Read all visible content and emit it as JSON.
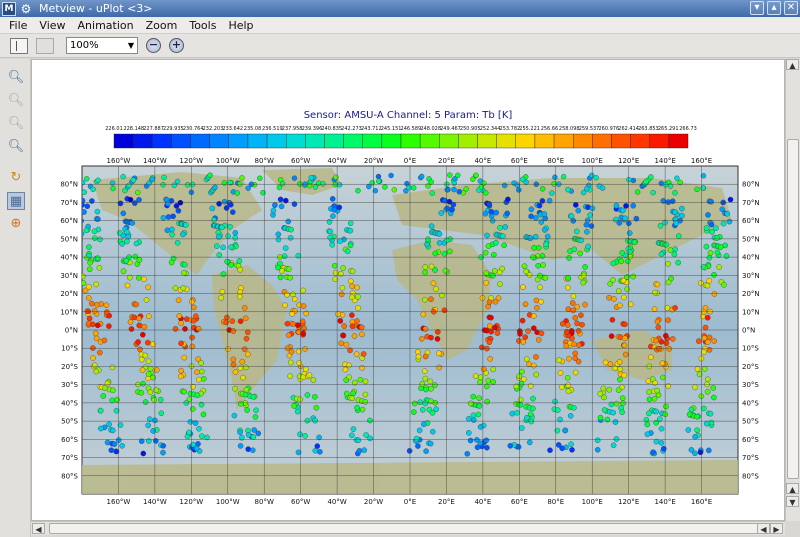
{
  "window": {
    "title": "Metview - uPlot <3>",
    "app_icon": "metview-app-icon",
    "controls": [
      "minimize-icon",
      "maximize-icon",
      "close-icon"
    ]
  },
  "menu": {
    "items": [
      "File",
      "View",
      "Animation",
      "Zoom",
      "Tools",
      "Help"
    ]
  },
  "toolbar": {
    "zoom_value": "100%",
    "icons": [
      "layout-icon",
      "frame-icon",
      "zoom-out-icon",
      "zoom-in-icon"
    ]
  },
  "left_tools": [
    "magnifier-icon",
    "zoom-in-icon",
    "zoom-out-icon",
    "zoom-area-icon",
    "data-probe-icon",
    "layers-icon",
    "globe-icon"
  ],
  "chart_data": {
    "type": "scatter",
    "title": "Sensor: AMSU-A Channel: 5 Param: Tb [K]",
    "colorbar": {
      "labels": [
        "226.01",
        "228.148",
        "227.887",
        "229.935",
        "230.764",
        "232.203",
        "233.642",
        "235.08",
        "236.519",
        "237.958",
        "239.396",
        "240.835",
        "242.273",
        "243.712",
        "245.151",
        "246.589",
        "248.028",
        "249.467",
        "250.905",
        "252.344",
        "253.782",
        "255.221",
        "256.66",
        "258.098",
        "259.537",
        "260.976",
        "262.414",
        "263.853",
        "265.291",
        "266.73"
      ],
      "colors": [
        "#0000d8",
        "#0019ea",
        "#0033ff",
        "#0050ff",
        "#006aff",
        "#0084ff",
        "#009efe",
        "#00b5f5",
        "#00c9ea",
        "#00dbd4",
        "#00e9b4",
        "#00f290",
        "#00f86a",
        "#00fd44",
        "#0aff1e",
        "#2dff00",
        "#55fa00",
        "#7df400",
        "#a2ee00",
        "#c6e800",
        "#e6e000",
        "#fcd400",
        "#ffbd00",
        "#ffa400",
        "#ff8a00",
        "#ff6e00",
        "#ff5200",
        "#ff3600",
        "#f91a00",
        "#ea0000"
      ],
      "range": [
        226.01,
        266.73
      ]
    },
    "x_axis": {
      "ticks": [
        "160°W",
        "140°W",
        "120°W",
        "100°W",
        "80°W",
        "60°W",
        "40°W",
        "20°W",
        "0°E",
        "20°E",
        "40°E",
        "60°E",
        "80°E",
        "100°E",
        "120°E",
        "140°E",
        "160°E"
      ],
      "range": [
        -180,
        180
      ]
    },
    "y_axis": {
      "ticks": [
        "80°N",
        "70°N",
        "60°N",
        "50°N",
        "40°N",
        "30°N",
        "20°N",
        "10°N",
        "0°N",
        "10°S",
        "20°S",
        "30°S",
        "40°S",
        "50°S",
        "60°S",
        "70°S",
        "80°S"
      ],
      "range": [
        -90,
        90
      ]
    },
    "grid": true,
    "swaths": [
      {
        "top_lon": -178,
        "bottom_lon": -163
      },
      {
        "top_lon": -155,
        "bottom_lon": -140
      },
      {
        "top_lon": -130,
        "bottom_lon": -115
      },
      {
        "top_lon": -103,
        "bottom_lon": -88
      },
      {
        "top_lon": -70,
        "bottom_lon": -55
      },
      {
        "top_lon": -40,
        "bottom_lon": -25
      },
      {
        "top_lon": 18,
        "bottom_lon": 6
      },
      {
        "top_lon": 48,
        "bottom_lon": 36
      },
      {
        "top_lon": 72,
        "bottom_lon": 60
      },
      {
        "top_lon": 95,
        "bottom_lon": 83
      },
      {
        "top_lon": 120,
        "bottom_lon": 108
      },
      {
        "top_lon": 145,
        "bottom_lon": 133
      },
      {
        "top_lon": 170,
        "bottom_lon": 158
      }
    ]
  }
}
